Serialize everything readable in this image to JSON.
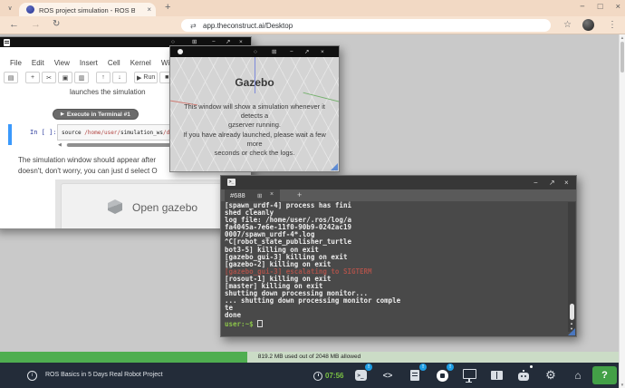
{
  "browser": {
    "tab_title": "ROS project simulation - ROS B",
    "url": "app.theconstruct.ai/Desktop",
    "new_tab_label": "+"
  },
  "jupyter": {
    "menu_items": [
      "File",
      "Edit",
      "View",
      "Insert",
      "Cell",
      "Kernel",
      "Widgets"
    ],
    "run_label": "Run",
    "cell_type": "Code",
    "intro_text": "launches the simulation",
    "execute_button_label": "Execute in Terminal #1",
    "cell_prompt": "In [ ]:",
    "code_tokens": [
      {
        "text": "source ",
        "type": "plain"
      },
      {
        "text": "/home/user/",
        "type": "path"
      },
      {
        "text": "simulation_ws",
        "type": "plain"
      },
      {
        "text": "/dev",
        "type": "path"
      }
    ],
    "paragraph_lines": [
      "The simulation window should appear after",
      "doesn't, don't worry, you can just d select O"
    ],
    "open_gazebo_label": "Open gazebo"
  },
  "gazebo": {
    "title": "Gazebo",
    "message1_lines": [
      "This window will show a simulation whenever it detects a",
      "gzserver running."
    ],
    "message2_lines": [
      "If you have already launched, please wait a few more",
      "seconds or check the logs."
    ]
  },
  "terminal": {
    "tab_label": "#688",
    "new_tab_label": "+",
    "lines": [
      {
        "text": "[spawn_urdf-4] process has fini"
      },
      {
        "text": "shed cleanly"
      },
      {
        "text": "log file: /home/user/.ros/log/a"
      },
      {
        "text": "fa4045a-7e6e-11f0-90b9-0242ac19"
      },
      {
        "text": "0007/spawn_urdf-4*.log"
      },
      {
        "text": "^C[robot_state_publisher_turtle"
      },
      {
        "text": "bot3-5] killing on exit"
      },
      {
        "text": "[gazebo_gui-3] killing on exit"
      },
      {
        "text": "[gazebo-2] killing on exit"
      },
      {
        "text": "[gazebo_gui-3] escalating to SIGTERM",
        "color": "red"
      },
      {
        "text": "[rosout-1] killing on exit"
      },
      {
        "text": "[master] killing on exit"
      },
      {
        "text": "shutting down processing monitor..."
      },
      {
        "text": "... shutting down processing monitor comple"
      },
      {
        "text": "te"
      },
      {
        "text": "done"
      }
    ],
    "prompt": "user:~$"
  },
  "memory": {
    "text": "819.2 MB used out of 2048 MB allowed",
    "used_mb": 819.2,
    "total_mb": 2048,
    "used_fraction": 0.4
  },
  "taskbar": {
    "course_title": "ROS Basics in 5 Days Real Robot Project",
    "clock": "07:56",
    "help_label": "?",
    "icons": [
      {
        "name": "terminal",
        "badge": "!"
      },
      {
        "name": "code"
      },
      {
        "name": "notebook",
        "badge": "!"
      },
      {
        "name": "simulation",
        "badge": "!"
      },
      {
        "name": "screen"
      },
      {
        "name": "book"
      },
      {
        "name": "robot",
        "dot": true
      },
      {
        "name": "gear"
      },
      {
        "name": "home"
      }
    ]
  },
  "colors": {
    "memory_green": "#4fae50",
    "badge_blue": "#1e9de3",
    "terminal_error_red": "#a8524a",
    "prompt_green": "#8bc34a",
    "help_green": "#43a047",
    "chrome_peach": "#f2d9c4"
  }
}
